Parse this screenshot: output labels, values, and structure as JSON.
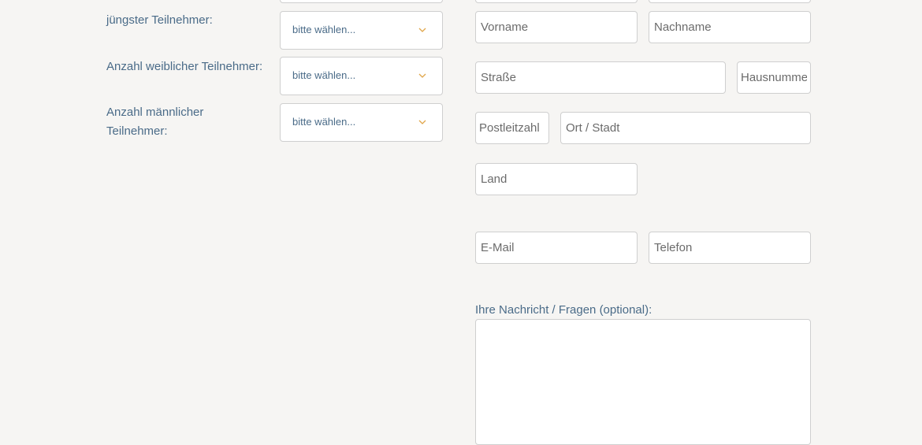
{
  "participants": {
    "youngest_label": "jüngster Teilnehmer:",
    "female_count_label": "Anzahl weiblicher Teilnehmer:",
    "male_count_label": "Anzahl männlicher Teilnehmer:",
    "select_placeholder": "bitte wählen..."
  },
  "contact": {
    "first_name_placeholder": "Vorname",
    "last_name_placeholder": "Nachname",
    "street_placeholder": "Straße",
    "house_number_placeholder": "Hausnummer",
    "postal_code_placeholder": "Postleitzahl",
    "city_placeholder": "Ort / Stadt",
    "country_placeholder": "Land",
    "email_placeholder": "E-Mail",
    "phone_placeholder": "Telefon",
    "message_label": "Ihre Nachricht / Fragen (optional):"
  },
  "colors": {
    "background": "#f6f5f3",
    "label_text": "#4a6b88",
    "chevron": "#e0a64a",
    "border": "#cfcfcf"
  },
  "icons": {
    "select_arrow": "chevron-down-icon"
  }
}
